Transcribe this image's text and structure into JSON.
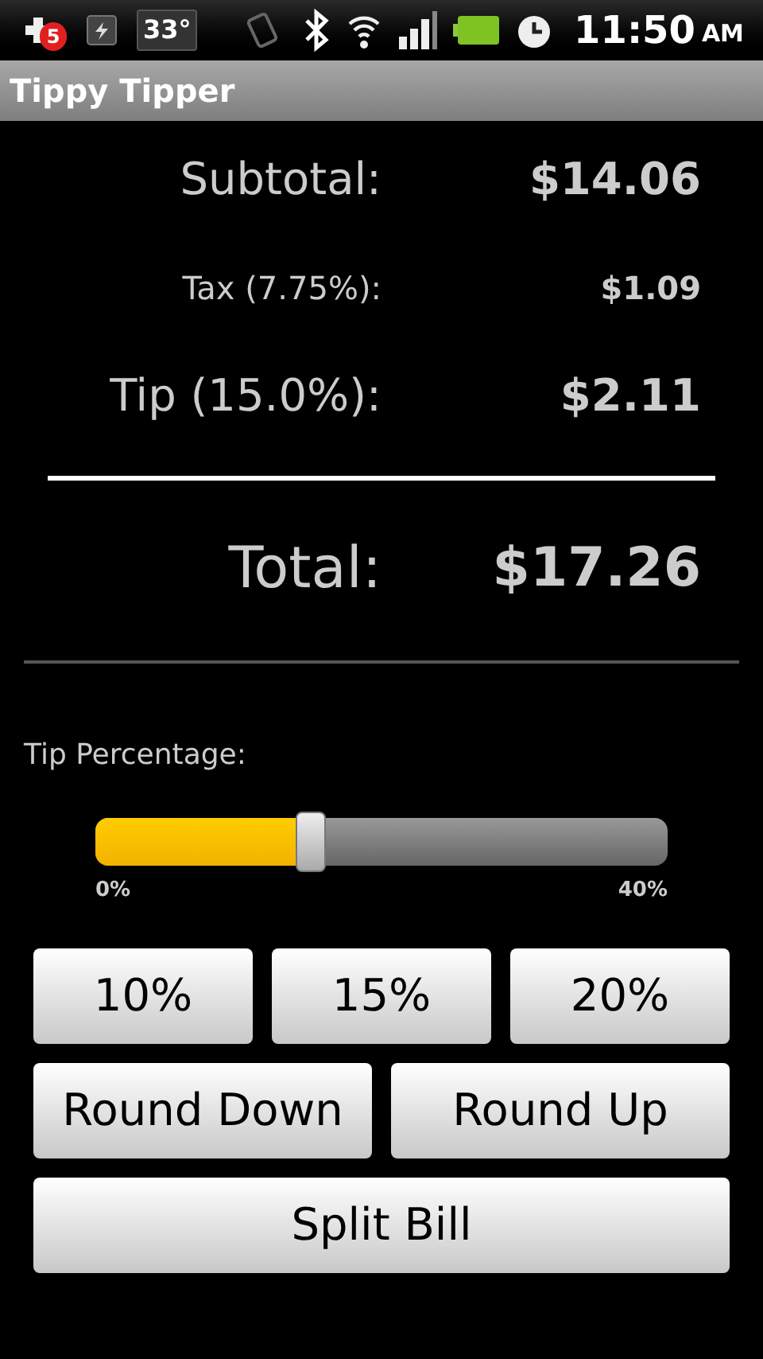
{
  "status_bar": {
    "notification_count": "5",
    "temperature": "33°",
    "time": "11:50",
    "meridiem": "AM"
  },
  "title_bar": {
    "title": "Tippy Tipper"
  },
  "summary": [
    {
      "kind": "line",
      "label": "Subtotal:",
      "value": "$14.06"
    },
    {
      "kind": "minor",
      "label": "Tax (7.75%):",
      "value": "$1.09"
    },
    {
      "kind": "line",
      "label": "Tip (15.0%):",
      "value": "$2.11"
    },
    {
      "kind": "total",
      "label": "Total:",
      "value": "$17.26"
    }
  ],
  "tip_slider": {
    "label": "Tip Percentage:",
    "level": 0.375,
    "min_label": "0%",
    "max_label": "40%"
  },
  "button_rows": [
    [
      "10%",
      "15%",
      "20%"
    ],
    [
      "Round Down",
      "Round Up"
    ],
    [
      "Split Bill"
    ]
  ]
}
